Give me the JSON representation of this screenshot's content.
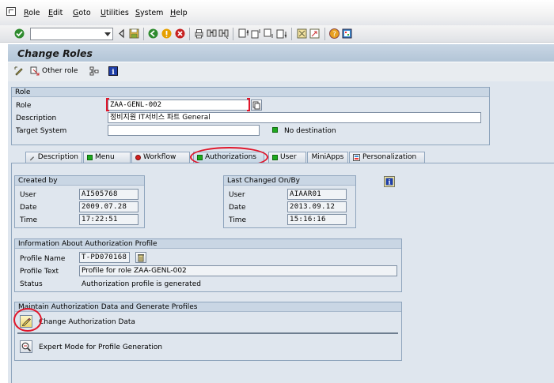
{
  "menubar": {
    "items": [
      {
        "label": "Role",
        "u": "R",
        "rest": "ole"
      },
      {
        "label": "Edit",
        "u": "E",
        "rest": "dit"
      },
      {
        "label": "Goto",
        "u": "G",
        "rest": "oto"
      },
      {
        "label": "Utilities",
        "u": "U",
        "rest": "tilities"
      },
      {
        "label": "System",
        "u": "S",
        "rest": "ystem"
      },
      {
        "label": "Help",
        "u": "H",
        "rest": "elp"
      }
    ]
  },
  "toolbar": {
    "command_value": ""
  },
  "title": "Change Roles",
  "app_toolbar": {
    "other_role_label": "Other role"
  },
  "role_group": {
    "title": "Role",
    "role_label": "Role",
    "role_value": "ZAA-GENL-002",
    "description_label": "Description",
    "description_value": "정비지원 IT서비스 파트 General",
    "target_label": "Target System",
    "target_value": "",
    "target_status": "No destination"
  },
  "tabs": [
    {
      "label": "Description",
      "icon": "pencil-icon",
      "status": "none"
    },
    {
      "label": "Menu",
      "icon": "green-status",
      "status": "green"
    },
    {
      "label": "Workflow",
      "icon": "red-status",
      "status": "red"
    },
    {
      "label": "Authorizations",
      "icon": "green-status",
      "status": "green",
      "active": true
    },
    {
      "label": "User",
      "icon": "green-status",
      "status": "green"
    },
    {
      "label": "MiniApps",
      "icon": "",
      "status": "none"
    },
    {
      "label": "Personalization",
      "icon": "personalization-icon",
      "status": "none"
    }
  ],
  "created_by": {
    "title": "Created by",
    "user_label": "User",
    "user_value": "AI505768",
    "date_label": "Date",
    "date_value": "2009.07.28",
    "time_label": "Time",
    "time_value": "17:22:51"
  },
  "last_changed": {
    "title": "Last Changed On/By",
    "user_label": "User",
    "user_value": "AIAAR01",
    "date_label": "Date",
    "date_value": "2013.09.12",
    "time_label": "Time",
    "time_value": "15:16:16"
  },
  "auth_profile": {
    "title": "Information About Authorization Profile",
    "profile_name_label": "Profile Name",
    "profile_name_value": "T-PD070168",
    "profile_text_label": "Profile Text",
    "profile_text_value": "Profile for role ZAA-GENL-002",
    "status_label": "Status",
    "status_value": "Authorization profile is generated"
  },
  "maintain": {
    "title": "Maintain Authorization Data and Generate Profiles",
    "change_label": "Change Authorization Data",
    "expert_label": "Expert Mode for Profile Generation"
  },
  "colors": {
    "annotation": "#e0162b",
    "title_bar": "#b3c5d7",
    "panel_bg": "#dfe6ee"
  }
}
